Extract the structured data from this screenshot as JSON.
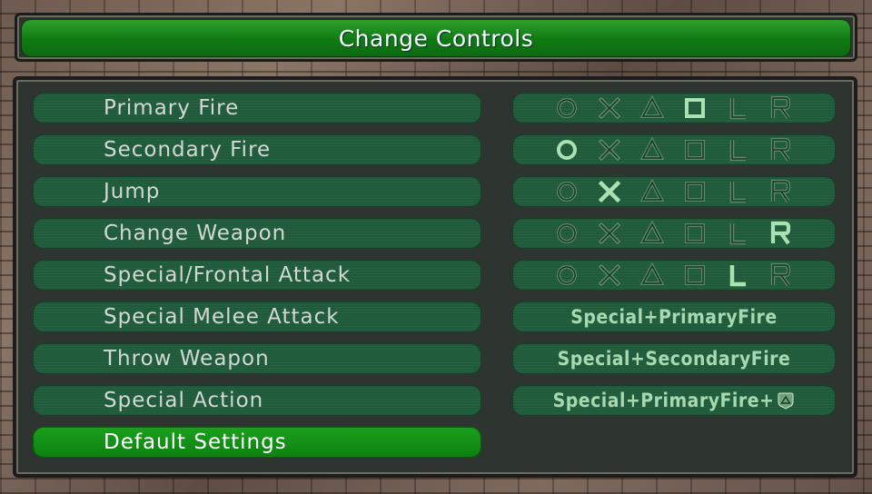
{
  "title": "Change Controls",
  "actions": [
    {
      "label": "Primary Fire",
      "binding": "square"
    },
    {
      "label": "Secondary Fire",
      "binding": "circle"
    },
    {
      "label": "Jump",
      "binding": "cross"
    },
    {
      "label": "Change Weapon",
      "binding": "R"
    },
    {
      "label": "Special/Frontal Attack",
      "binding": "L"
    },
    {
      "label": "Special Melee Attack",
      "combo": "Special+PrimaryFire"
    },
    {
      "label": "Throw Weapon",
      "combo": "Special+SecondaryFire"
    },
    {
      "label": "Special Action",
      "combo": "Special+PrimaryFire+",
      "combo_icon": "triangle-icon"
    }
  ],
  "buttons": [
    "circle",
    "cross",
    "triangle",
    "square",
    "L",
    "R"
  ],
  "default_label": "Default Settings",
  "colors": {
    "title_green": "#0f7a13",
    "row_green": "#1f5b3a",
    "selected_green": "#0d8010",
    "icon_active": "#b8f0c0",
    "icon_inactive": "#5a8a68"
  }
}
